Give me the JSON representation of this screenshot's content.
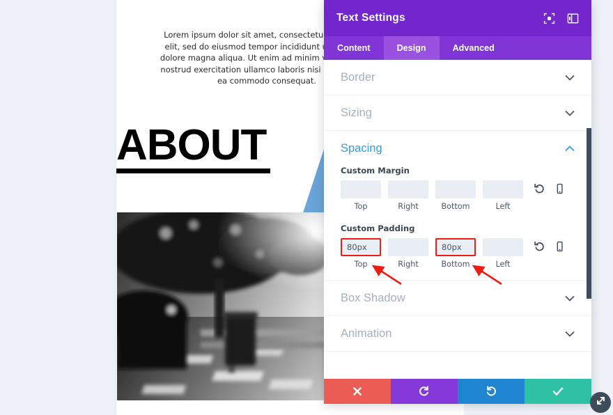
{
  "website": {
    "paragraph": "Lorem ipsum dolor sit amet, consectetur adipiscing elit, sed do eiusmod tempor incididunt ut labore et dolore magna aliqua. Ut enim ad minim veniam, quis nostrud exercitation ullamco laboris nisi ut aliquip ex ea commodo consequat.",
    "heading": "ABOUT",
    "shape_color": "#6aa4d8",
    "photo_alt": "man-sitting-on-bench-bw-photo"
  },
  "panel": {
    "title": "Text Settings",
    "header_color": "#7326cc",
    "tabs": [
      {
        "label": "Content",
        "active": false
      },
      {
        "label": "Design",
        "active": true
      },
      {
        "label": "Advanced",
        "active": false
      }
    ],
    "header_icons": [
      {
        "name": "focus-icon"
      },
      {
        "name": "layout-panel-icon"
      }
    ],
    "sections": [
      {
        "label": "Border",
        "open": false
      },
      {
        "label": "Sizing",
        "open": false
      },
      {
        "label": "Spacing",
        "open": true
      },
      {
        "label": "Box Shadow",
        "open": false
      },
      {
        "label": "Animation",
        "open": false
      }
    ],
    "spacing": {
      "margin": {
        "label": "Custom Margin",
        "fields": [
          {
            "caption": "Top",
            "value": "",
            "placeholder": "",
            "marked": false
          },
          {
            "caption": "Right",
            "value": "",
            "placeholder": "",
            "marked": false
          },
          {
            "caption": "Bottom",
            "value": "",
            "placeholder": "",
            "marked": false
          },
          {
            "caption": "Left",
            "value": "",
            "placeholder": "",
            "marked": false
          }
        ],
        "actions": [
          "reset-icon",
          "responsive-icon"
        ]
      },
      "padding": {
        "label": "Custom Padding",
        "fields": [
          {
            "caption": "Top",
            "value": "80px",
            "placeholder": "",
            "marked": true
          },
          {
            "caption": "Right",
            "value": "",
            "placeholder": "",
            "marked": false
          },
          {
            "caption": "Bottom",
            "value": "80px",
            "placeholder": "",
            "marked": true
          },
          {
            "caption": "Left",
            "value": "",
            "placeholder": "",
            "marked": false
          }
        ],
        "actions": [
          "reset-icon",
          "responsive-icon"
        ]
      }
    },
    "footer_buttons": [
      {
        "name": "cancel-button",
        "icon": "close-icon",
        "color": "#ea5c54"
      },
      {
        "name": "undo-button",
        "icon": "undo-icon",
        "color": "#8639d9"
      },
      {
        "name": "redo-button",
        "icon": "redo-icon",
        "color": "#2085d0"
      },
      {
        "name": "save-button",
        "icon": "check-icon",
        "color": "#2ec1a4"
      }
    ],
    "resize_handle": "resize-icon",
    "annotation_color": "#ee1c12"
  }
}
